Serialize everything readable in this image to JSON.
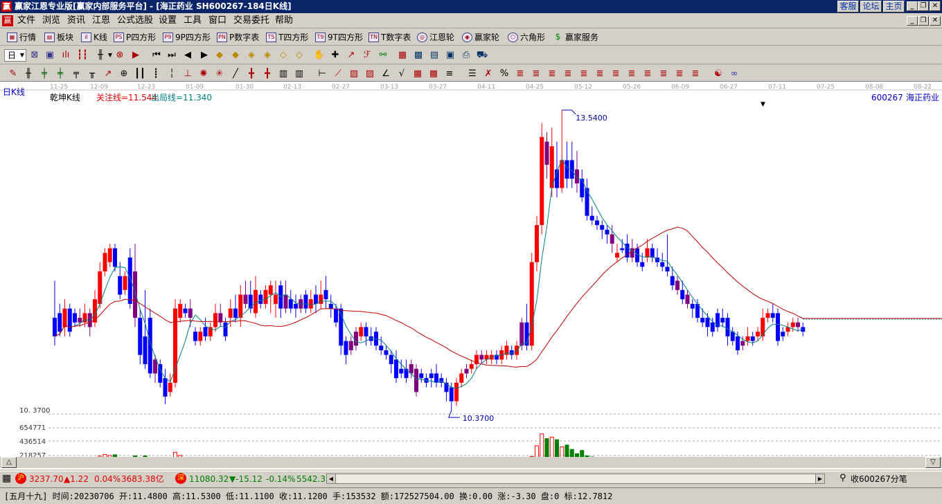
{
  "titlebar": {
    "text": "赢家江恩专业版[赢家内部服务平台] - [海正药业  SH600267-184日K线]",
    "btn_customer": "客服",
    "btn_forum": "论坛",
    "btn_home": "主页"
  },
  "menu": [
    "文件",
    "浏览",
    "资讯",
    "江恩",
    "公式选股",
    "设置",
    "工具",
    "窗口",
    "交易委托",
    "帮助"
  ],
  "toolbar1": [
    {
      "label": "行情",
      "icon": "quote-table-icon"
    },
    {
      "label": "板块",
      "icon": "sector-grid-icon"
    },
    {
      "label": "K线",
      "icon": "kline-icon"
    },
    {
      "label": "P四方形",
      "icon": "p-square-icon",
      "badge": "PS"
    },
    {
      "label": "9P四方形",
      "icon": "9p-square-icon",
      "badge": "P9"
    },
    {
      "label": "P数字表",
      "icon": "p-number-table-icon",
      "badge": "PN"
    },
    {
      "label": "T四方形",
      "icon": "t-square-icon",
      "badge": "TS"
    },
    {
      "label": "9T四方形",
      "icon": "9t-square-icon",
      "badge": "T9"
    },
    {
      "label": "T数字表",
      "icon": "t-number-table-icon",
      "badge": "TN"
    },
    {
      "label": "江恩轮",
      "icon": "gann-wheel-icon"
    },
    {
      "label": "赢家轮",
      "icon": "winner-wheel-icon"
    },
    {
      "label": "六角形",
      "icon": "hexagon-icon"
    },
    {
      "label": "赢家服务",
      "icon": "dollar-service-icon"
    }
  ],
  "period_select": "日",
  "chart_header": {
    "period_label": "日K线",
    "indicator_name": "乾坤K线",
    "focus_line": "关注线=11.544",
    "exit_line": "出局线=11.340",
    "stock_code": "600267",
    "stock_name": "海正药业"
  },
  "colors": {
    "up": "#ff0000",
    "down": "#0000ff",
    "special": "#800080",
    "ma_short": "#008080",
    "ma_long": "#c00000",
    "vol_up": "#ff0000",
    "vol_down": "#008000"
  },
  "chart_data": {
    "type": "candlestick",
    "date_ticks": [
      "11-25",
      "12-09",
      "12-23",
      "01-09",
      "01-30",
      "02-13",
      "02-27",
      "03-13",
      "03-27",
      "04-11",
      "04-25",
      "05-12",
      "05-26",
      "06-09",
      "06-27",
      "07-11",
      "07-25",
      "08-08",
      "08-22"
    ],
    "price_range": [
      10.0,
      14.0
    ],
    "high_marker": "13.5400",
    "low_marker": "10.3700",
    "low_axis_label": "10. 3700",
    "volume_axis": [
      "654771",
      "436514",
      "218257"
    ],
    "candles": [
      {
        "o": 11.3,
        "c": 11.1,
        "h": 11.7,
        "l": 11.0
      },
      {
        "o": 11.35,
        "c": 11.15,
        "h": 11.45,
        "l": 11.1
      },
      {
        "o": 11.2,
        "c": 11.4,
        "h": 11.5,
        "l": 11.1
      },
      {
        "o": 11.4,
        "c": 11.15,
        "h": 11.45,
        "l": 11.1
      },
      {
        "o": 11.35,
        "c": 11.25,
        "h": 11.4,
        "l": 11.2
      },
      {
        "o": 11.3,
        "c": 11.25,
        "h": 11.4,
        "l": 11.2
      },
      {
        "o": 11.25,
        "c": 11.35,
        "h": 11.45,
        "l": 11.2
      },
      {
        "o": 11.2,
        "c": 11.35,
        "h": 11.4,
        "l": 11.1
      },
      {
        "o": 11.25,
        "c": 11.5,
        "h": 11.6,
        "l": 11.2
      },
      {
        "o": 11.45,
        "c": 11.8,
        "h": 11.9,
        "l": 11.4
      },
      {
        "o": 11.8,
        "c": 12.0,
        "h": 12.05,
        "l": 11.75
      },
      {
        "o": 11.9,
        "c": 12.05,
        "h": 12.1,
        "l": 11.85
      },
      {
        "o": 12.05,
        "c": 11.85,
        "h": 12.1,
        "l": 11.8
      },
      {
        "o": 11.75,
        "c": 11.55,
        "h": 11.9,
        "l": 11.5
      },
      {
        "o": 11.6,
        "c": 11.75,
        "h": 11.8,
        "l": 11.55
      },
      {
        "o": 11.95,
        "c": 11.45,
        "h": 12.05,
        "l": 11.4
      },
      {
        "o": 11.8,
        "c": 11.3,
        "h": 12.1,
        "l": 11.2
      },
      {
        "o": 11.3,
        "c": 10.9,
        "h": 11.4,
        "l": 10.8
      },
      {
        "o": 11.1,
        "c": 10.8,
        "h": 11.6,
        "l": 10.75
      },
      {
        "o": 11.3,
        "c": 10.7,
        "h": 11.4,
        "l": 10.65
      },
      {
        "o": 10.85,
        "c": 10.7,
        "h": 10.9,
        "l": 10.6
      },
      {
        "o": 10.8,
        "c": 10.6,
        "h": 10.85,
        "l": 10.55
      },
      {
        "o": 10.65,
        "c": 10.45,
        "h": 10.75,
        "l": 10.37
      },
      {
        "o": 10.5,
        "c": 10.6,
        "h": 10.7,
        "l": 10.45
      },
      {
        "o": 10.6,
        "c": 11.4,
        "h": 11.5,
        "l": 10.55
      },
      {
        "o": 11.3,
        "c": 11.45,
        "h": 11.5,
        "l": 11.25
      },
      {
        "o": 11.4,
        "c": 11.35,
        "h": 11.45,
        "l": 11.3
      },
      {
        "o": 11.3,
        "c": 11.4,
        "h": 11.5,
        "l": 11.2
      },
      {
        "o": 11.15,
        "c": 11.05,
        "h": 11.2,
        "l": 11.0
      },
      {
        "o": 11.05,
        "c": 11.15,
        "h": 11.2,
        "l": 11.0
      },
      {
        "o": 11.2,
        "c": 11.1,
        "h": 11.3,
        "l": 11.05
      },
      {
        "o": 11.1,
        "c": 11.2,
        "h": 11.25,
        "l": 11.05
      },
      {
        "o": 11.2,
        "c": 11.35,
        "h": 11.45,
        "l": 11.15
      },
      {
        "o": 11.35,
        "c": 11.25,
        "h": 11.45,
        "l": 11.2
      },
      {
        "o": 11.25,
        "c": 11.1,
        "h": 11.3,
        "l": 11.05
      },
      {
        "o": 11.3,
        "c": 11.4,
        "h": 11.5,
        "l": 11.2
      },
      {
        "o": 11.4,
        "c": 11.3,
        "h": 11.55,
        "l": 11.25
      },
      {
        "o": 11.3,
        "c": 11.55,
        "h": 11.65,
        "l": 11.2
      },
      {
        "o": 11.55,
        "c": 11.45,
        "h": 11.7,
        "l": 11.4
      },
      {
        "o": 11.55,
        "c": 11.4,
        "h": 11.7,
        "l": 11.35
      },
      {
        "o": 11.35,
        "c": 11.6,
        "h": 11.75,
        "l": 11.3
      },
      {
        "o": 11.55,
        "c": 11.45,
        "h": 11.6,
        "l": 11.4
      },
      {
        "o": 11.45,
        "c": 11.6,
        "h": 11.65,
        "l": 11.4
      },
      {
        "o": 11.55,
        "c": 11.65,
        "h": 11.7,
        "l": 11.35
      },
      {
        "o": 11.45,
        "c": 11.55,
        "h": 11.7,
        "l": 11.3
      },
      {
        "o": 11.65,
        "c": 11.4,
        "h": 11.7,
        "l": 11.3
      },
      {
        "o": 11.4,
        "c": 11.55,
        "h": 11.7,
        "l": 11.35
      },
      {
        "o": 11.5,
        "c": 11.4,
        "h": 11.6,
        "l": 11.35
      },
      {
        "o": 11.45,
        "c": 11.4,
        "h": 11.55,
        "l": 11.3
      },
      {
        "o": 11.4,
        "c": 11.5,
        "h": 11.55,
        "l": 11.35
      },
      {
        "o": 11.55,
        "c": 11.4,
        "h": 11.6,
        "l": 11.35
      },
      {
        "o": 11.4,
        "c": 11.5,
        "h": 11.6,
        "l": 11.35
      },
      {
        "o": 11.55,
        "c": 11.45,
        "h": 11.65,
        "l": 11.35
      },
      {
        "o": 11.45,
        "c": 11.55,
        "h": 11.7,
        "l": 11.4
      },
      {
        "o": 11.6,
        "c": 11.5,
        "h": 11.75,
        "l": 11.4
      },
      {
        "o": 11.45,
        "c": 11.4,
        "h": 11.55,
        "l": 11.3
      },
      {
        "o": 11.4,
        "c": 11.25,
        "h": 11.45,
        "l": 11.2
      },
      {
        "o": 11.4,
        "c": 11.0,
        "h": 11.45,
        "l": 10.9
      },
      {
        "o": 11.05,
        "c": 10.9,
        "h": 11.1,
        "l": 10.8
      },
      {
        "o": 10.95,
        "c": 11.05,
        "h": 11.1,
        "l": 10.9
      },
      {
        "o": 11.15,
        "c": 11.0,
        "h": 11.2,
        "l": 10.95
      },
      {
        "o": 11.1,
        "c": 11.2,
        "h": 11.25,
        "l": 11.05
      },
      {
        "o": 11.2,
        "c": 11.1,
        "h": 11.25,
        "l": 11.0
      },
      {
        "o": 11.1,
        "c": 11.05,
        "h": 11.2,
        "l": 11.0
      },
      {
        "o": 11.15,
        "c": 11.0,
        "h": 11.2,
        "l": 10.95
      },
      {
        "o": 11.0,
        "c": 10.95,
        "h": 11.1,
        "l": 10.9
      },
      {
        "o": 10.95,
        "c": 10.9,
        "h": 11.0,
        "l": 10.85
      },
      {
        "o": 10.9,
        "c": 10.8,
        "h": 10.95,
        "l": 10.7
      },
      {
        "o": 10.85,
        "c": 10.65,
        "h": 10.95,
        "l": 10.6
      },
      {
        "o": 10.75,
        "c": 10.7,
        "h": 10.85,
        "l": 10.65
      },
      {
        "o": 10.75,
        "c": 10.65,
        "h": 10.85,
        "l": 10.6
      },
      {
        "o": 10.8,
        "c": 10.7,
        "h": 10.85,
        "l": 10.65
      },
      {
        "o": 10.75,
        "c": 10.5,
        "h": 10.8,
        "l": 10.45
      },
      {
        "o": 10.7,
        "c": 10.65,
        "h": 10.75,
        "l": 10.6
      },
      {
        "o": 10.65,
        "c": 10.6,
        "h": 10.7,
        "l": 10.55
      },
      {
        "o": 10.7,
        "c": 10.65,
        "h": 10.75,
        "l": 10.55
      },
      {
        "o": 10.7,
        "c": 10.6,
        "h": 10.8,
        "l": 10.55
      },
      {
        "o": 10.65,
        "c": 10.6,
        "h": 10.7,
        "l": 10.55
      },
      {
        "o": 10.6,
        "c": 10.5,
        "h": 10.65,
        "l": 10.4
      },
      {
        "o": 10.55,
        "c": 10.4,
        "h": 10.6,
        "l": 10.3
      },
      {
        "o": 10.4,
        "c": 10.6,
        "h": 10.65,
        "l": 10.35
      },
      {
        "o": 10.6,
        "c": 10.7,
        "h": 10.75,
        "l": 10.55
      },
      {
        "o": 10.7,
        "c": 10.75,
        "h": 10.8,
        "l": 10.65
      },
      {
        "o": 10.75,
        "c": 10.8,
        "h": 10.85,
        "l": 10.7
      },
      {
        "o": 10.8,
        "c": 10.9,
        "h": 10.95,
        "l": 10.75
      },
      {
        "o": 10.85,
        "c": 10.9,
        "h": 10.95,
        "l": 10.8
      },
      {
        "o": 10.85,
        "c": 10.9,
        "h": 10.95,
        "l": 10.8
      },
      {
        "o": 10.85,
        "c": 10.9,
        "h": 10.95,
        "l": 10.8
      },
      {
        "o": 10.9,
        "c": 10.85,
        "h": 10.95,
        "l": 10.8
      },
      {
        "o": 10.85,
        "c": 10.95,
        "h": 11.0,
        "l": 10.8
      },
      {
        "o": 10.9,
        "c": 11.0,
        "h": 11.05,
        "l": 10.85
      },
      {
        "o": 10.95,
        "c": 10.9,
        "h": 11.0,
        "l": 10.85
      },
      {
        "o": 10.9,
        "c": 11.0,
        "h": 11.05,
        "l": 10.85
      },
      {
        "o": 11.0,
        "c": 11.25,
        "h": 11.3,
        "l": 10.95
      },
      {
        "o": 11.25,
        "c": 11.0,
        "h": 11.45,
        "l": 10.95
      },
      {
        "o": 11.0,
        "c": 11.9,
        "h": 12.0,
        "l": 10.95
      },
      {
        "o": 11.9,
        "c": 12.3,
        "h": 12.4,
        "l": 11.8
      },
      {
        "o": 12.3,
        "c": 13.25,
        "h": 13.4,
        "l": 12.2
      },
      {
        "o": 13.2,
        "c": 12.95,
        "h": 13.3,
        "l": 12.8
      },
      {
        "o": 12.7,
        "c": 13.15,
        "h": 13.35,
        "l": 12.6
      },
      {
        "o": 12.9,
        "c": 12.7,
        "h": 13.2,
        "l": 12.6
      },
      {
        "o": 12.7,
        "c": 13.0,
        "h": 13.54,
        "l": 12.65
      },
      {
        "o": 13.0,
        "c": 12.8,
        "h": 13.2,
        "l": 12.7
      },
      {
        "o": 13.0,
        "c": 12.8,
        "h": 13.2,
        "l": 12.7
      },
      {
        "o": 12.9,
        "c": 12.75,
        "h": 13.1,
        "l": 12.65
      },
      {
        "o": 12.8,
        "c": 12.6,
        "h": 12.9,
        "l": 12.55
      },
      {
        "o": 12.7,
        "c": 12.4,
        "h": 12.8,
        "l": 12.35
      },
      {
        "o": 12.4,
        "c": 12.35,
        "h": 12.5,
        "l": 12.3
      },
      {
        "o": 12.35,
        "c": 12.3,
        "h": 12.4,
        "l": 12.25
      },
      {
        "o": 12.3,
        "c": 12.25,
        "h": 12.35,
        "l": 12.15
      },
      {
        "o": 12.25,
        "c": 12.2,
        "h": 12.3,
        "l": 12.1
      },
      {
        "o": 12.2,
        "c": 12.1,
        "h": 12.3,
        "l": 12.0
      },
      {
        "o": 11.95,
        "c": 12.0,
        "h": 12.1,
        "l": 11.9
      },
      {
        "o": 12.05,
        "c": 12.03,
        "h": 12.15,
        "l": 12.0
      },
      {
        "o": 12.1,
        "c": 11.95,
        "h": 12.2,
        "l": 11.9
      },
      {
        "o": 11.95,
        "c": 12.05,
        "h": 12.15,
        "l": 11.9
      },
      {
        "o": 12.05,
        "c": 11.9,
        "h": 12.1,
        "l": 11.85
      },
      {
        "o": 11.9,
        "c": 11.85,
        "h": 12.0,
        "l": 11.8
      },
      {
        "o": 11.95,
        "c": 12.05,
        "h": 12.15,
        "l": 11.9
      },
      {
        "o": 12.05,
        "c": 11.95,
        "h": 12.1,
        "l": 11.9
      },
      {
        "o": 11.95,
        "c": 11.9,
        "h": 12.05,
        "l": 11.85
      },
      {
        "o": 11.9,
        "c": 11.85,
        "h": 12.0,
        "l": 11.8
      },
      {
        "o": 11.85,
        "c": 11.8,
        "h": 12.2,
        "l": 11.75
      },
      {
        "o": 11.75,
        "c": 11.65,
        "h": 11.85,
        "l": 11.6
      },
      {
        "o": 11.7,
        "c": 11.6,
        "h": 11.75,
        "l": 11.55
      },
      {
        "o": 11.6,
        "c": 11.5,
        "h": 11.7,
        "l": 11.45
      },
      {
        "o": 11.55,
        "c": 11.45,
        "h": 11.6,
        "l": 11.4
      },
      {
        "o": 11.45,
        "c": 11.4,
        "h": 11.5,
        "l": 11.3
      },
      {
        "o": 11.45,
        "c": 11.3,
        "h": 11.5,
        "l": 11.25
      },
      {
        "o": 11.3,
        "c": 11.25,
        "h": 11.4,
        "l": 11.2
      },
      {
        "o": 11.3,
        "c": 11.2,
        "h": 11.35,
        "l": 11.1
      },
      {
        "o": 11.25,
        "c": 11.15,
        "h": 11.3,
        "l": 11.1
      },
      {
        "o": 11.35,
        "c": 11.2,
        "h": 11.4,
        "l": 11.15
      },
      {
        "o": 11.3,
        "c": 11.25,
        "h": 11.4,
        "l": 11.2
      },
      {
        "o": 11.3,
        "c": 11.1,
        "h": 11.35,
        "l": 11.0
      },
      {
        "o": 11.15,
        "c": 11.05,
        "h": 11.2,
        "l": 11.0
      },
      {
        "o": 11.1,
        "c": 10.95,
        "h": 11.15,
        "l": 10.9
      },
      {
        "o": 11.05,
        "c": 11.0,
        "h": 11.1,
        "l": 10.95
      },
      {
        "o": 11.05,
        "c": 11.1,
        "h": 11.2,
        "l": 11.0
      },
      {
        "o": 11.1,
        "c": 11.05,
        "h": 11.15,
        "l": 11.0
      },
      {
        "o": 11.1,
        "c": 11.15,
        "h": 11.2,
        "l": 11.05
      },
      {
        "o": 11.1,
        "c": 11.3,
        "h": 11.4,
        "l": 11.05
      },
      {
        "o": 11.3,
        "c": 11.35,
        "h": 11.4,
        "l": 11.25
      },
      {
        "o": 11.35,
        "c": 11.3,
        "h": 11.45,
        "l": 11.25
      },
      {
        "o": 11.35,
        "c": 11.05,
        "h": 11.4,
        "l": 11.0
      },
      {
        "o": 11.15,
        "c": 11.1,
        "h": 11.2,
        "l": 11.05
      },
      {
        "o": 11.15,
        "c": 11.2,
        "h": 11.25,
        "l": 11.1
      },
      {
        "o": 11.2,
        "c": 11.25,
        "h": 11.3,
        "l": 11.15
      },
      {
        "o": 11.25,
        "c": 11.2,
        "h": 11.3,
        "l": 11.15
      },
      {
        "o": 11.2,
        "c": 11.15,
        "h": 11.25,
        "l": 11.1
      }
    ],
    "volumes": [
      0.05,
      0.07,
      0.08,
      0.06,
      0.05,
      0.06,
      0.08,
      0.06,
      0.12,
      0.17,
      0.2,
      0.18,
      0.2,
      0.14,
      0.1,
      0.14,
      0.18,
      0.12,
      0.18,
      0.12,
      0.1,
      0.08,
      0.12,
      0.08,
      0.24,
      0.18,
      0.12,
      0.1,
      0.08,
      0.06,
      0.09,
      0.08,
      0.12,
      0.14,
      0.1,
      0.11,
      0.1,
      0.12,
      0.1,
      0.11,
      0.1,
      0.09,
      0.1,
      0.08,
      0.09,
      0.11,
      0.12,
      0.1,
      0.09,
      0.11,
      0.09,
      0.1,
      0.11,
      0.12,
      0.1,
      0.11,
      0.09,
      0.12,
      0.1,
      0.09,
      0.08,
      0.09,
      0.07,
      0.08,
      0.06,
      0.08,
      0.07,
      0.09,
      0.07,
      0.08,
      0.06,
      0.07,
      0.06,
      0.05,
      0.06,
      0.05,
      0.06,
      0.05,
      0.05,
      0.06,
      0.05,
      0.05,
      0.06,
      0.05,
      0.06,
      0.06,
      0.05,
      0.06,
      0.05,
      0.07,
      0.05,
      0.06,
      0.05,
      0.08,
      0.12,
      0.16,
      0.36,
      0.58,
      0.5,
      0.52,
      0.48,
      0.34,
      0.38,
      0.3,
      0.22,
      0.28,
      0.18,
      0.16,
      0.14,
      0.12,
      0.14,
      0.12,
      0.1,
      0.11,
      0.12,
      0.1,
      0.09,
      0.1,
      0.11,
      0.09,
      0.1,
      0.08,
      0.09,
      0.1,
      0.11,
      0.12,
      0.1,
      0.08,
      0.09,
      0.1,
      0.08,
      0.06,
      0.07,
      0.05,
      0.08,
      0.1,
      0.08,
      0.06,
      0.05,
      0.06,
      0.05,
      0.04,
      0.05,
      0.04
    ]
  },
  "status": {
    "sh_badge": "沪",
    "sh_index": "3237.70",
    "sh_change": "▲1.22",
    "sh_pct": "0.04%",
    "sh_amount": "3683.38亿",
    "sz_badge": "深",
    "sz_index": "11080.32",
    "sz_change": "▼-15.12",
    "sz_pct": "-0.14%",
    "sz_amount": "5542.3",
    "receive": "收600267分笔"
  },
  "infobar": "[五月十九] 时间:20230706 开:11.4800 高:11.5300 低:11.1100 收:11.1200 手:153532 额:172527504.00 换:0.00 涨:-3.30 盘:0 标:12.7812"
}
